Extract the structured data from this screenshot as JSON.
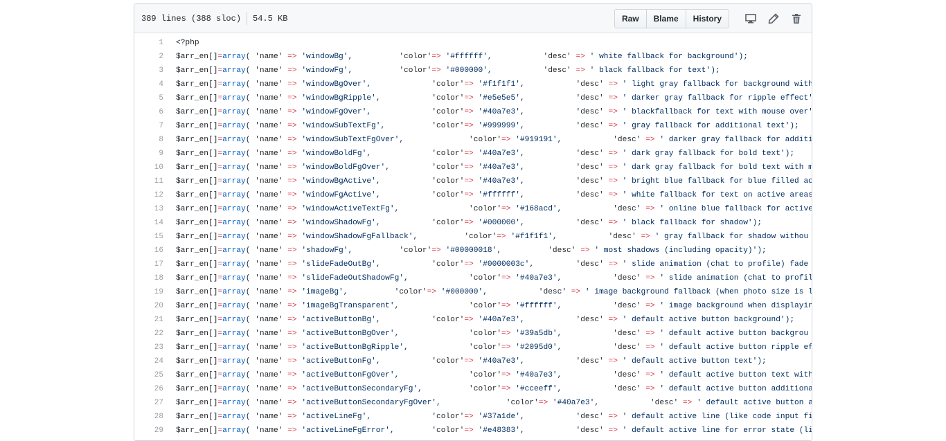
{
  "header": {
    "lines": "389 lines (388 sloc)",
    "size": "54.5 KB",
    "buttons": {
      "raw": "Raw",
      "blame": "Blame",
      "history": "History"
    }
  },
  "icons": {
    "desktop": "desktop-icon",
    "edit": "pencil-icon",
    "delete": "trash-icon"
  },
  "code": {
    "open_tag": "<?php",
    "lines": [
      {
        "n": "1"
      },
      {
        "n": "2",
        "name": "'windowBg',",
        "pad1": "          ",
        "color": "'#ffffff',",
        "pad2": "           ",
        "desc": "' white fallback for background');"
      },
      {
        "n": "3",
        "name": "'windowFg',",
        "pad1": "          ",
        "color": "'#000000',",
        "pad2": "           ",
        "desc": "' black fallback for text');"
      },
      {
        "n": "4",
        "name": "'windowBgOver',",
        "pad1": "             ",
        "color": "'#f1f1f1',",
        "pad2": "           ",
        "desc": "' light gray fallback for background with"
      },
      {
        "n": "5",
        "name": "'windowBgRipple',",
        "pad1": "           ",
        "color": "'#e5e5e5',",
        "pad2": "           ",
        "desc": "' darker gray fallback for ripple effect'"
      },
      {
        "n": "6",
        "name": "'windowFgOver',",
        "pad1": "             ",
        "color": "'#40a7e3',",
        "pad2": "           ",
        "desc": "' blackfallback for text with mouse over'"
      },
      {
        "n": "7",
        "name": "'windowSubTextFg',",
        "pad1": "          ",
        "color": "'#999999',",
        "pad2": "           ",
        "desc": "' gray fallback for additional text');"
      },
      {
        "n": "8",
        "name": "'windowSubTextFgOver',",
        "pad1": "              ",
        "color": "'#919191',",
        "pad2": "           ",
        "desc": "' darker gray fallback for additi"
      },
      {
        "n": "9",
        "name": "'windowBoldFg',",
        "pad1": "             ",
        "color": "'#40a7e3',",
        "pad2": "           ",
        "desc": "' dark gray fallback for bold text');"
      },
      {
        "n": "10",
        "name": "'windowBoldFgOver',",
        "pad1": "         ",
        "color": "'#40a7e3',",
        "pad2": "           ",
        "desc": "' dark gray fallback for bold text with mo"
      },
      {
        "n": "11",
        "name": "'windowBgActive',",
        "pad1": "           ",
        "color": "'#40a7e3',",
        "pad2": "           ",
        "desc": "' bright blue fallback for blue filled ac"
      },
      {
        "n": "12",
        "name": "'windowFgActive',",
        "pad1": "           ",
        "color": "'#ffffff',",
        "pad2": "           ",
        "desc": "' white fallback for text on active areas"
      },
      {
        "n": "13",
        "name": "'windowActiveTextFg',",
        "pad1": "               ",
        "color": "'#168acd',",
        "pad2": "           ",
        "desc": "' online blue fallback for active"
      },
      {
        "n": "14",
        "name": "'windowShadowFg',",
        "pad1": "           ",
        "color": "'#000000',",
        "pad2": "           ",
        "desc": "' black fallback for shadow');"
      },
      {
        "n": "15",
        "name": "'windowShadowFgFallback',",
        "pad1": "          ",
        "color": "'#f1f1f1',",
        "pad2": "           ",
        "desc": "' gray fallback for shadow withou"
      },
      {
        "n": "16",
        "name": "'shadowFg',",
        "pad1": "          ",
        "color": "'#00000018',",
        "pad2": "          ",
        "desc": "' most shadows (including opacity)');"
      },
      {
        "n": "17",
        "name": "'slideFadeOutBg',",
        "pad1": "           ",
        "color": "'#0000003c',",
        "pad2": "         ",
        "desc": "' slide animation (chat to profile) fade o"
      },
      {
        "n": "18",
        "name": "'slideFadeOutShadowFg',",
        "pad1": "             ",
        "color": "'#40a7e3',",
        "pad2": "           ",
        "desc": "' slide animation (chat to profil"
      },
      {
        "n": "19",
        "name": "'imageBg',",
        "pad1": "          ",
        "color": "'#000000',",
        "pad2": "           ",
        "desc": "' image background fallback (when photo size is le"
      },
      {
        "n": "20",
        "name": "'imageBgTransparent',",
        "pad1": "               ",
        "color": "'#ffffff',",
        "pad2": "           ",
        "desc": "' image background when displayin"
      },
      {
        "n": "21",
        "name": "'activeButtonBg',",
        "pad1": "           ",
        "color": "'#40a7e3',",
        "pad2": "           ",
        "desc": "' default active button background');"
      },
      {
        "n": "22",
        "name": "'activeButtonBgOver',",
        "pad1": "               ",
        "color": "'#39a5db',",
        "pad2": "           ",
        "desc": "' default active button backgrou"
      },
      {
        "n": "23",
        "name": "'activeButtonBgRipple',",
        "pad1": "             ",
        "color": "'#2095d0',",
        "pad2": "           ",
        "desc": "' default active button ripple ef"
      },
      {
        "n": "24",
        "name": "'activeButtonFg',",
        "pad1": "           ",
        "color": "'#40a7e3',",
        "pad2": "           ",
        "desc": "' default active button text');"
      },
      {
        "n": "25",
        "name": "'activeButtonFgOver',",
        "pad1": "               ",
        "color": "'#40a7e3',",
        "pad2": "           ",
        "desc": "' default active button text with"
      },
      {
        "n": "26",
        "name": "'activeButtonSecondaryFg',",
        "pad1": "          ",
        "color": "'#cceeff',",
        "pad2": "           ",
        "desc": "' default active button additiona"
      },
      {
        "n": "27",
        "name": "'activeButtonSecondaryFgOver',",
        "pad1": "              ",
        "color": "'#40a7e3',",
        "pad2": "           ",
        "desc": "' default active button a"
      },
      {
        "n": "28",
        "name": "'activeLineFg',",
        "pad1": "             ",
        "color": "'#37a1de',",
        "pad2": "           ",
        "desc": "' default active line (like code input fi"
      },
      {
        "n": "29",
        "name": "'activeLineFgError',",
        "pad1": "        ",
        "color": "'#e48383',",
        "pad2": "           ",
        "desc": "' default active line for error state (li"
      }
    ]
  },
  "colors": {
    "keyword": "#d73a49",
    "function": "#005cc5",
    "string": "#032f62",
    "line_number": "#959da5"
  }
}
